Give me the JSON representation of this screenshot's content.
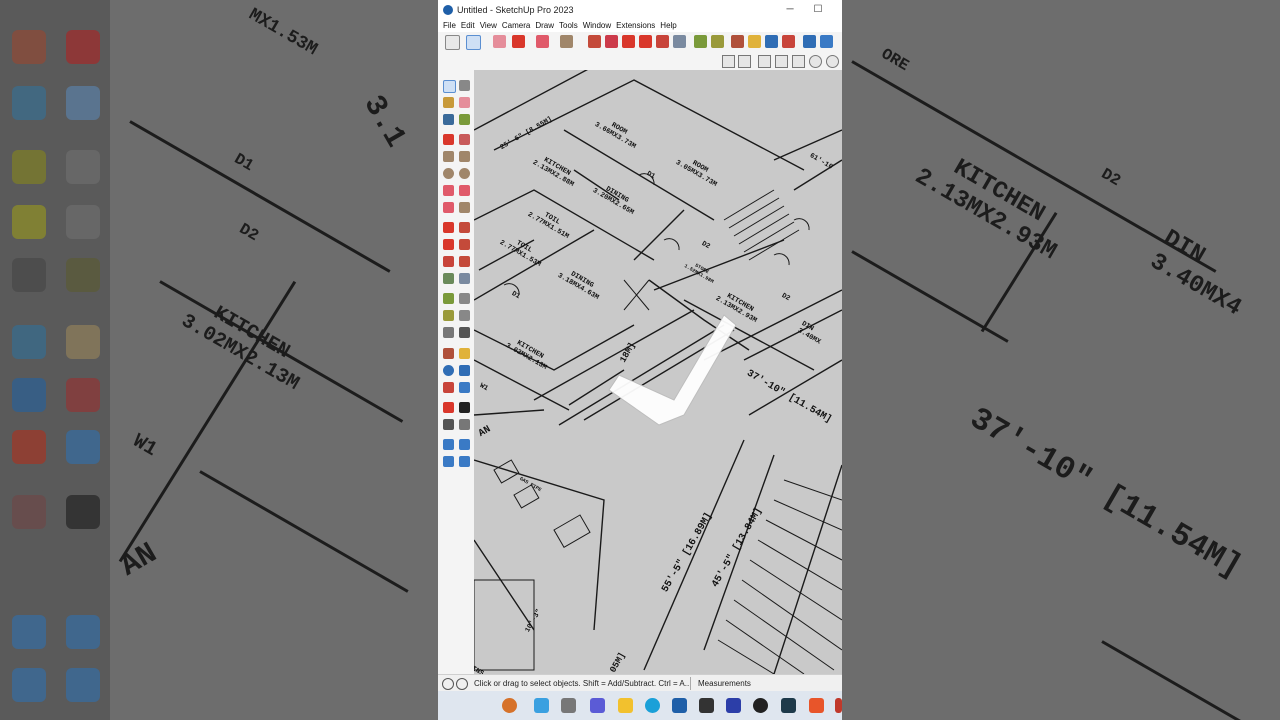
{
  "window": {
    "title": "Untitled - SketchUp Pro 2023",
    "minimize_glyph": "─",
    "maximize_glyph": "☐"
  },
  "menu": [
    "File",
    "Edit",
    "View",
    "Camera",
    "Draw",
    "Tools",
    "Window",
    "Extensions",
    "Help"
  ],
  "status": {
    "message": "Click or drag to select objects. Shift = Add/Subtract. Ctrl = A...",
    "measurements_label": "Measurements"
  },
  "plan_labels": {
    "room1": "ROOM\n3.66MX3.73M",
    "room2": "ROOM\n3.05MX3.73M",
    "kitchen1": "KITCHEN\n2.13MX2.88M",
    "dining1": "DINING\n3.20MX2.65M",
    "toil1": "TOIL\n2.77MX1.51M",
    "toil2": "TOIL\n2.77MX1.53M",
    "dining2": "DINING\n3.18MX4.63M",
    "kitchen2": "KITCHEN\n3.02MX2.13M",
    "store": "STORE\n1.52MX1.98M",
    "kitchen3": "KITCHEN\n2.13MX2.93M",
    "din3": "DIN\n3.40MX",
    "dim_3710": "37'-10\" [11.54M]",
    "dim_5555": "55'-5\" [16.89M]",
    "dim_4545": "45'-5\" [13.84M]",
    "dim_2510": "25'-6\" [8.55M]",
    "dim_618": "61'-10",
    "d1a": "D1",
    "d1b": "D1",
    "d2a": "D2",
    "d2b": "D2",
    "w1": "W1",
    "an": "AN",
    "gas_pipe": "GAS PIPE",
    "m18": "18M]",
    "m05": "05M]",
    "dim_103": "10'-3\"",
    "ins": "INS"
  },
  "background_labels": {
    "kitchen_right": "KITCHEN\n2.13MX2.93M",
    "kitchen_left": "KITCHEN\n3.02MX2.13M",
    "dim_right": "37'-10\" [11.54M]",
    "din_right": "DIN\n3.40MX4",
    "d1": "D1",
    "d2": "D2",
    "d2r": "D2",
    "w1": "W1",
    "an": "AN",
    "mx153": "MX1.53M",
    "n318": "3.1",
    "ore": "ORE"
  },
  "colors": {
    "accent_red": "#d9372b",
    "accent_blue": "#2f6db5",
    "accent_yellow": "#e0b23a"
  }
}
